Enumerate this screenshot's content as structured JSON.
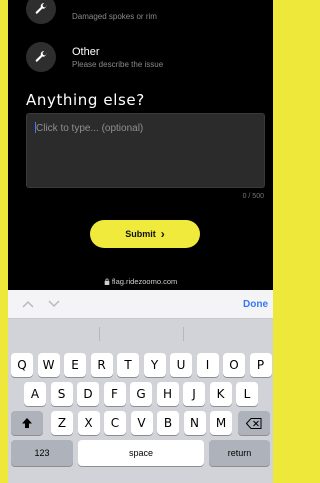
{
  "options": [
    {
      "title": "",
      "subtitle": "Damaged spokes or rim",
      "icon": "wrench-icon"
    },
    {
      "title": "Other",
      "subtitle": "Please describe the issue",
      "icon": "wrench-icon"
    }
  ],
  "form": {
    "heading": "Anything else?",
    "placeholder": "Click to type... (optional)",
    "counter": "0 / 500",
    "submit_label": "Submit",
    "submit_icon": "›"
  },
  "url": "flag.ridezoomo.com",
  "keyboard": {
    "done_label": "Done",
    "row1": [
      "Q",
      "W",
      "E",
      "R",
      "T",
      "Y",
      "U",
      "I",
      "O",
      "P"
    ],
    "row2": [
      "A",
      "S",
      "D",
      "F",
      "G",
      "H",
      "J",
      "K",
      "L"
    ],
    "row3": [
      "Z",
      "X",
      "C",
      "V",
      "B",
      "N",
      "M"
    ],
    "numbers_label": "123",
    "space_label": "space",
    "return_label": "return"
  },
  "colors": {
    "accent": "#f0ea3c",
    "ios_blue": "#3478f6"
  }
}
